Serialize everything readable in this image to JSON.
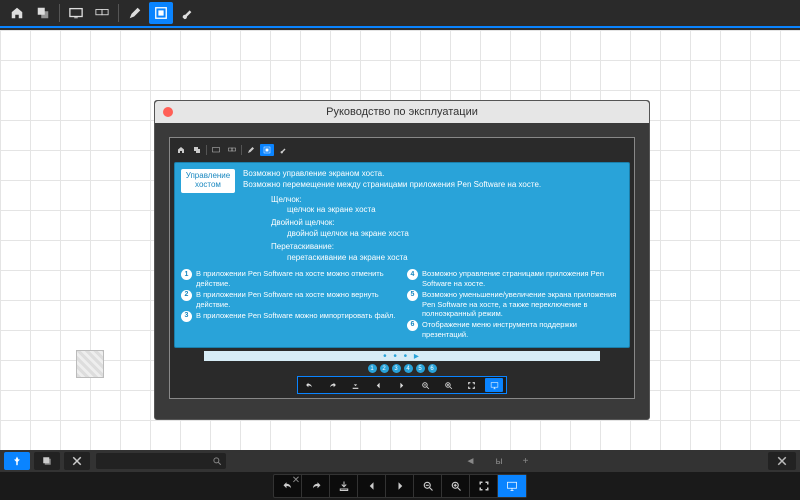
{
  "topbar": {
    "icons": [
      "home",
      "layers",
      "screen",
      "monitors",
      "pen",
      "overlay",
      "brush"
    ]
  },
  "window": {
    "title": "Руководство по эксплуатации",
    "host_label": "Управление хостом",
    "desc1": "Возможно управление экраном хоста.",
    "desc2": "Возможно перемещение между страницами приложения Pen Software на хосте.",
    "gestures": [
      {
        "title": "Щелчок:",
        "desc": "щелчок на экране хоста"
      },
      {
        "title": "Двойной щелчок:",
        "desc": "двойной щелчок на экране хоста"
      },
      {
        "title": "Перетаскивание:",
        "desc": "перетаскивание на экране хоста"
      }
    ],
    "numbered_left": [
      {
        "n": "1",
        "t": "В приложении Pen Software на хосте можно отменить действие."
      },
      {
        "n": "2",
        "t": "В приложении Pen Software на хосте можно вернуть действие."
      },
      {
        "n": "3",
        "t": "В приложение Pen Software можно импортировать файл."
      }
    ],
    "numbered_right": [
      {
        "n": "4",
        "t": "Возможно управление страницами приложения Pen Software на хосте."
      },
      {
        "n": "5",
        "t": "Возможно уменьшение/увеличение экрана приложения Pen Software на хосте, а также переключение в полноэкранный режим."
      },
      {
        "n": "6",
        "t": "Отображение меню инструмента поддержки презентаций."
      }
    ],
    "page_dots": [
      "1",
      "2",
      "3",
      "4",
      "5",
      "6"
    ]
  },
  "bottom": {
    "page_info": "✕",
    "prev": "◄",
    "sep": "ы",
    "next": "+"
  }
}
